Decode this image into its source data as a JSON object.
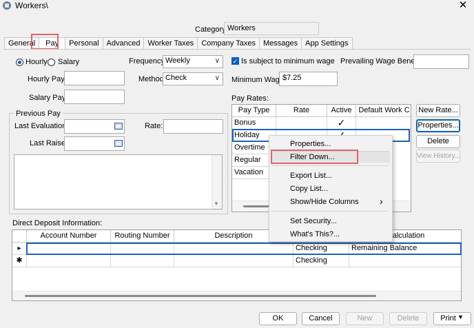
{
  "window": {
    "title": "Workers\\"
  },
  "header": {
    "category_label": "Category:",
    "category_value": "Workers"
  },
  "tabs": [
    "General",
    "Pay",
    "Personal",
    "Advanced",
    "Worker Taxes",
    "Company Taxes",
    "Messages",
    "App Settings"
  ],
  "active_tab": "Pay",
  "pay": {
    "hourly_label": "Hourly",
    "salary_label": "Salary",
    "selected_pay_type": "Hourly",
    "hourly_pay_label": "Hourly Pay:",
    "hourly_pay_value": "",
    "salary_pay_label": "Salary Pay:",
    "salary_pay_value": "",
    "frequency_label": "Frequency:",
    "frequency_value": "Weekly",
    "method_label": "Method:",
    "method_value": "Check",
    "min_wage_check_label": "Is subject to minimum wage",
    "min_wage_checked": true,
    "min_wage_label": "Minimum Wage:",
    "min_wage_value": "$7.25",
    "prevailing_label": "Prevailing Wage Benefit:",
    "prevailing_value": ""
  },
  "previous_pay": {
    "title": "Previous Pay",
    "last_eval_label": "Last Evaluation:",
    "last_eval_value": "",
    "rate_label": "Rate:",
    "rate_value": "",
    "last_raise_label": "Last Raise:",
    "last_raise_value": ""
  },
  "pay_rates": {
    "label": "Pay Rates:",
    "columns": [
      "Pay Type",
      "Rate",
      "Active",
      "Default Work C"
    ],
    "rows": [
      {
        "type": "Bonus",
        "rate": "",
        "active": "✓"
      },
      {
        "type": "Holiday",
        "rate": "",
        "active": "✓"
      },
      {
        "type": "Overtime",
        "rate": "",
        "active": ""
      },
      {
        "type": "Regular",
        "rate": "",
        "active": ""
      },
      {
        "type": "Vacation",
        "rate": "",
        "active": ""
      }
    ],
    "buttons": {
      "new_rate": "New Rate...",
      "properties": "Properties...",
      "delete": "Delete",
      "view_history": "View History..."
    }
  },
  "context_menu": {
    "items": [
      "Properties...",
      "Filter Down...",
      "Export List...",
      "Copy List...",
      "Show/Hide Columns",
      "Set Security...",
      "What's This?..."
    ],
    "submenu_arrow": "›"
  },
  "direct_deposit": {
    "label": "Direct Deposit Information:",
    "columns": [
      "Account Number",
      "Routing Number",
      "Description",
      "",
      "Calculation"
    ],
    "rows": [
      {
        "marker": "▸",
        "account": "",
        "routing": "",
        "description": "",
        "type": "Checking",
        "calculation": "Remaining Balance"
      },
      {
        "marker": "✱",
        "account": "",
        "routing": "",
        "description": "",
        "type": "Checking",
        "calculation": ""
      }
    ]
  },
  "footer": {
    "ok": "OK",
    "cancel": "Cancel",
    "new": "New",
    "delete": "Delete",
    "print": "Print"
  },
  "colors": {
    "highlight": "#e0636a",
    "accent": "#0d5ec8",
    "selection": "#1a62b8"
  }
}
